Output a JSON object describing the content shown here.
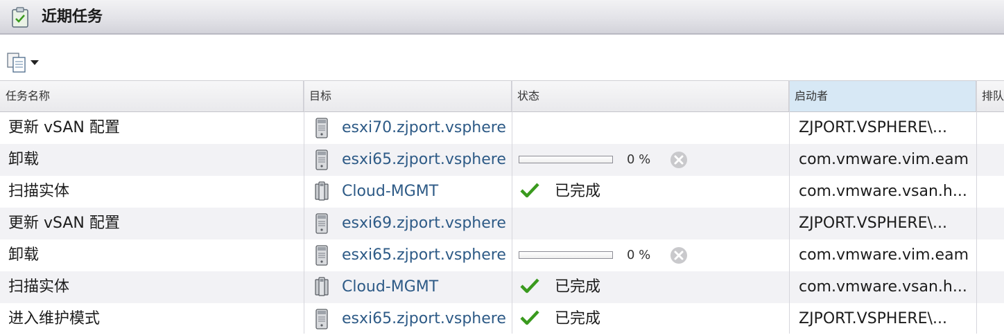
{
  "panel": {
    "title": "近期任务"
  },
  "columns": [
    "任务名称",
    "目标",
    "状态",
    "启动者",
    "排队"
  ],
  "rows": [
    {
      "name": "更新 vSAN 配置",
      "target": "esxi70.zjport.vsphere",
      "target_type": "host-icon",
      "status_type": "none",
      "status_text": "",
      "progress_percent": null,
      "initiator": "ZJPORT.VSPHERE\\..."
    },
    {
      "name": "卸载",
      "target": "esxi65.zjport.vsphere",
      "target_type": "host-icon",
      "status_type": "progress",
      "status_text": "0 %",
      "progress_percent": 0,
      "initiator": "com.vmware.vim.eam"
    },
    {
      "name": "扫描实体",
      "target": "Cloud-MGMT",
      "target_type": "cluster-icon",
      "status_type": "done",
      "status_text": "已完成",
      "progress_percent": null,
      "initiator": "com.vmware.vsan.h..."
    },
    {
      "name": "更新 vSAN 配置",
      "target": "esxi69.zjport.vsphere",
      "target_type": "host-icon",
      "status_type": "none",
      "status_text": "",
      "progress_percent": null,
      "initiator": "ZJPORT.VSPHERE\\..."
    },
    {
      "name": "卸载",
      "target": "esxi65.zjport.vsphere",
      "target_type": "host-icon",
      "status_type": "progress",
      "status_text": "0 %",
      "progress_percent": 0,
      "initiator": "com.vmware.vim.eam"
    },
    {
      "name": "扫描实体",
      "target": "Cloud-MGMT",
      "target_type": "cluster-icon",
      "status_type": "done",
      "status_text": "已完成",
      "progress_percent": null,
      "initiator": "com.vmware.vsan.h..."
    },
    {
      "name": "进入维护模式",
      "target": "esxi65.zjport.vsphere",
      "target_type": "host-icon",
      "status_type": "done",
      "status_text": "已完成",
      "progress_percent": null,
      "initiator": "ZJPORT.VSPHERE\\..."
    }
  ],
  "colors": {
    "link": "#2d5a86",
    "check": "#3a9a1e",
    "selected_header": "#d7e8f5"
  }
}
